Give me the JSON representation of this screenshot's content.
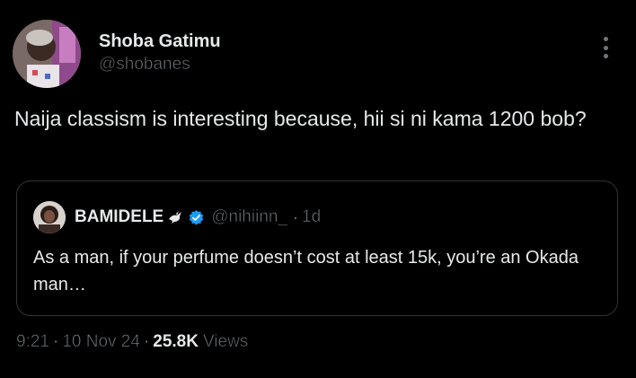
{
  "author": {
    "display_name": "Shoba Gatimu",
    "handle": "@shobanes",
    "avatar_icon": "profile-photo"
  },
  "menu_icon": "more-vertical-icon",
  "tweet": {
    "text": "Naija classism is interesting because, hii si ni kama 1200 bob?"
  },
  "quote": {
    "display_name": "BAMIDELE",
    "emoji_icon": "dove-icon",
    "verified": true,
    "verified_color": "#1d9bf0",
    "handle": "@nihiinn_",
    "separator": "·",
    "time": "1d",
    "text": "As a man, if your perfume doesn’t cost at least 15k, you’re an Okada man…"
  },
  "meta": {
    "time": "9:21",
    "separator": "·",
    "date": "10 Nov 24",
    "views_count": "25.8K",
    "views_label": "Views"
  },
  "colors": {
    "background": "#000000",
    "text_primary": "#e7e9ea",
    "text_secondary": "#71767b",
    "border": "#2f3336"
  }
}
